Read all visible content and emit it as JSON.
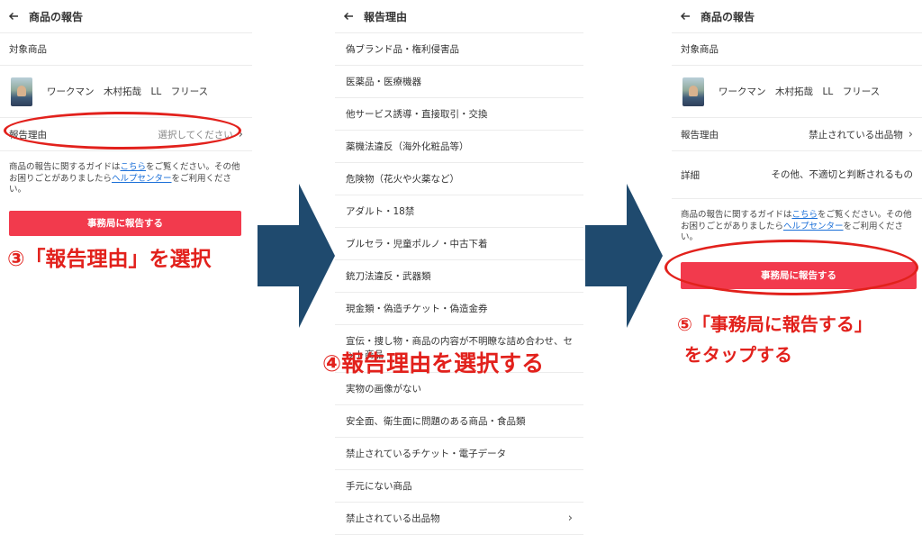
{
  "screen1": {
    "header_title": "商品の報告",
    "target_label": "対象商品",
    "product_name": "ワークマン　木村拓哉　LL　フリース",
    "reason_label": "報告理由",
    "reason_placeholder": "選択してください",
    "guide_text_1": "商品の報告に関するガイドは",
    "guide_link_1": "こちら",
    "guide_text_2": "をご覧ください。その他お困りごとがありましたら",
    "guide_link_2": "ヘルプセンター",
    "guide_text_3": "をご利用ください。",
    "submit_label": "事務局に報告する"
  },
  "screen2": {
    "header_title": "報告理由",
    "reasons": [
      "偽ブランド品・権利侵害品",
      "医薬品・医療機器",
      "他サービス誘導・直接取引・交換",
      "薬機法違反（海外化粧品等）",
      "危険物（花火や火薬など）",
      "アダルト・18禁",
      "ブルセラ・児童ポルノ・中古下着",
      "銃刀法違反・武器類",
      "現金類・偽造チケット・偽造金券",
      "宣伝・捜し物・商品の内容が不明瞭な詰め合わせ、セット商品",
      "実物の画像がない",
      "安全面、衛生面に問題のある商品・食品類",
      "禁止されているチケット・電子データ",
      "手元にない商品",
      "禁止されている出品物"
    ]
  },
  "screen3": {
    "header_title": "商品の報告",
    "target_label": "対象商品",
    "product_name": "ワークマン　木村拓哉　LL　フリース",
    "reason_label": "報告理由",
    "reason_value": "禁止されている出品物",
    "detail_label": "詳細",
    "detail_value": "その他、不適切と判断されるもの",
    "guide_text_1": "商品の報告に関するガイドは",
    "guide_link_1": "こちら",
    "guide_text_2": "をご覧ください。その他お困りごとがありましたら",
    "guide_link_2": "ヘルプセンター",
    "guide_text_3": "をご利用ください。",
    "submit_label": "事務局に報告する"
  },
  "annotations": {
    "step3": "③「報告理由」を選択",
    "step4": "④報告理由を選択する",
    "step5_line1": "⑤「事務局に報告する」",
    "step5_line2": "をタップする"
  },
  "colors": {
    "accent_red": "#f23a4d",
    "annotation_red": "#e2211c",
    "arrow_navy": "#1f4a6e",
    "link_blue": "#1a6fd8"
  },
  "icons": {
    "back": "back-arrow-icon",
    "chevron": "chevron-right-icon"
  }
}
